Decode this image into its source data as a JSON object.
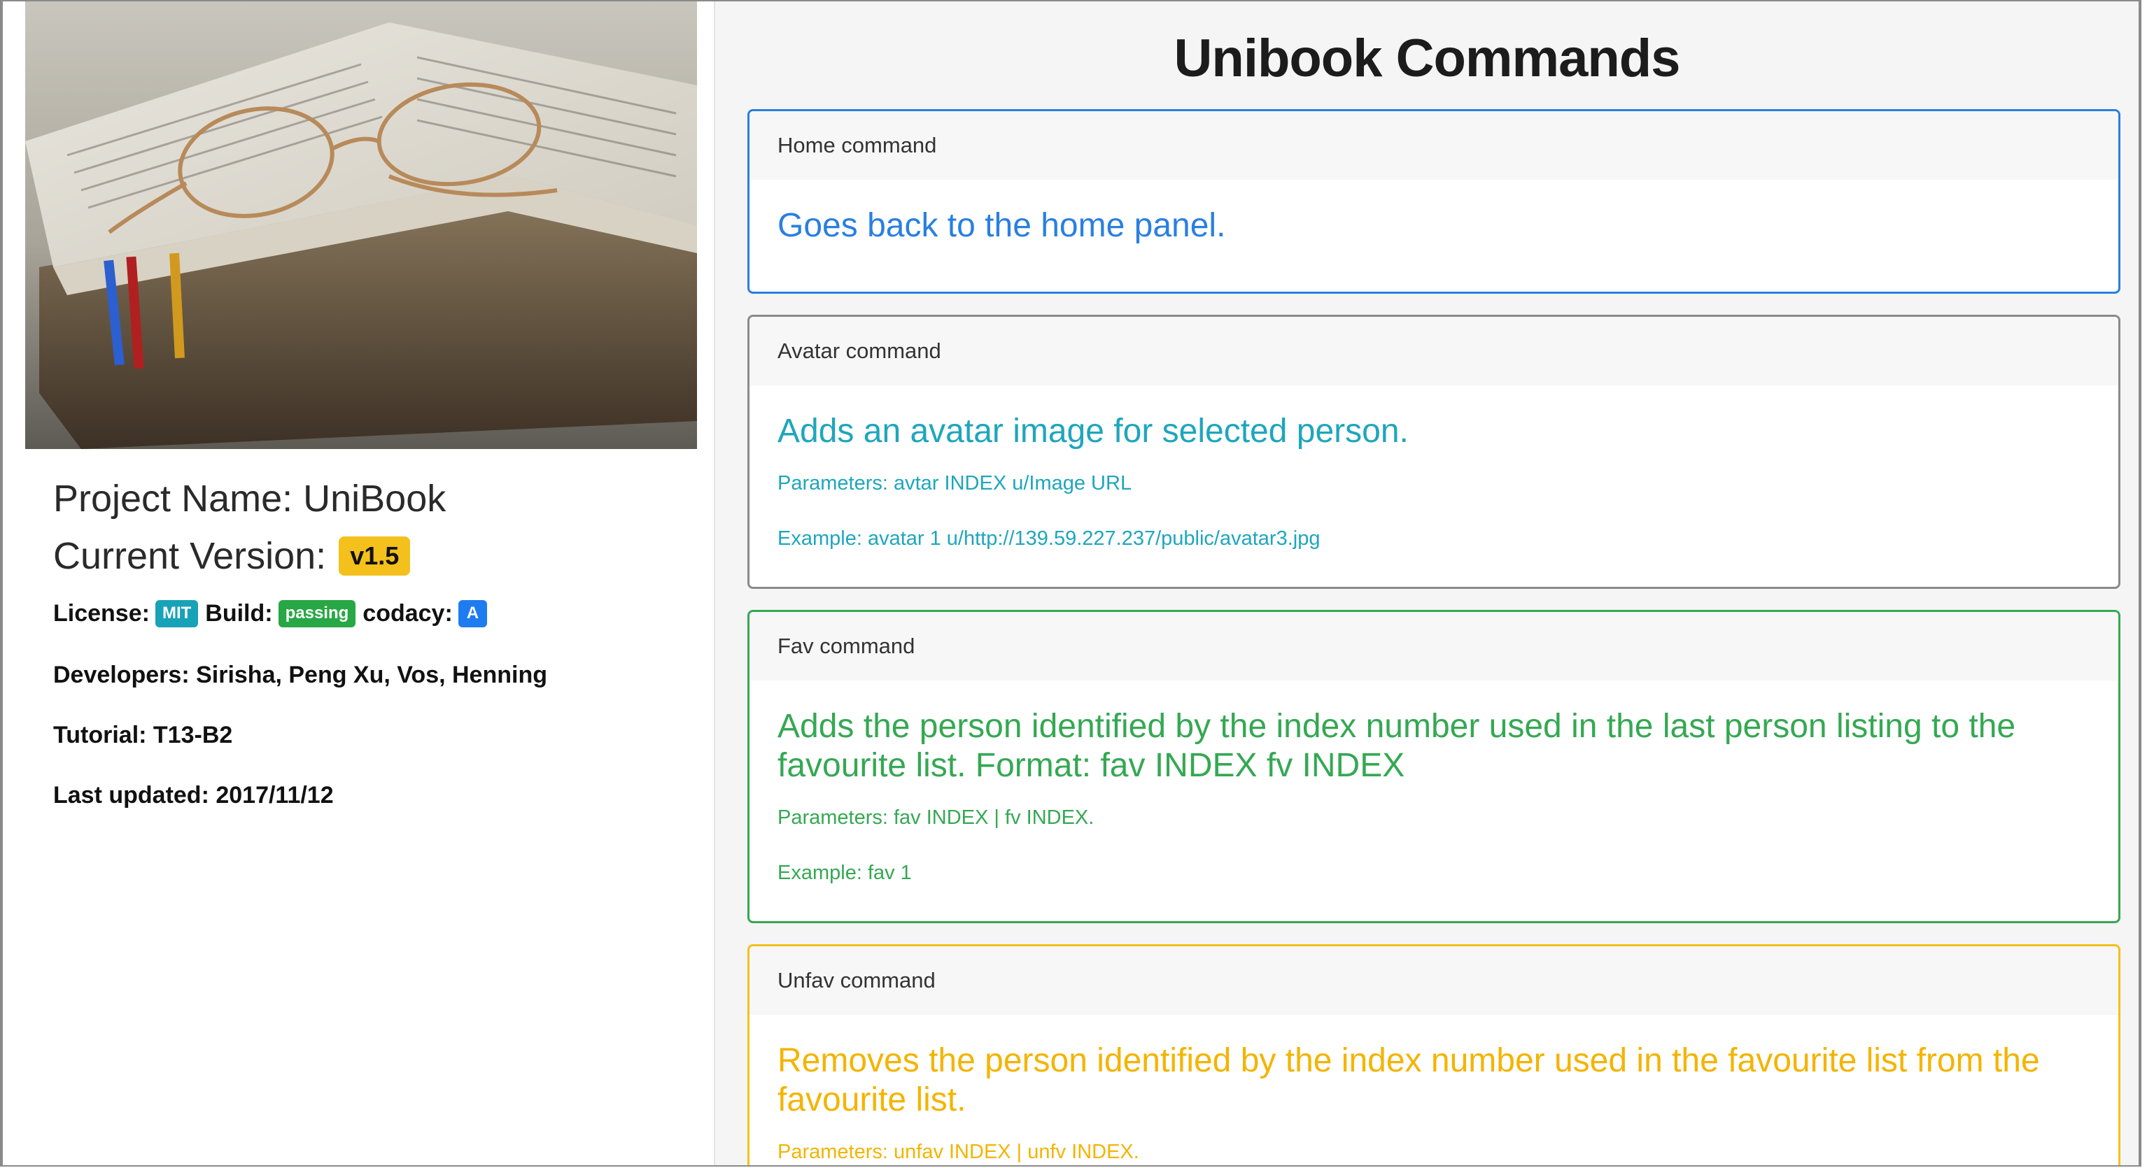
{
  "sidebar": {
    "project_name": "Project Name: UniBook",
    "current_version_label": "Current Version:",
    "version": "v1.5",
    "license_label": "License:",
    "license_badge": "MIT",
    "build_label": "Build:",
    "build_badge": "passing",
    "codacy_label": "codacy:",
    "codacy_badge": "A",
    "developers": "Developers: Sirisha, Peng Xu, Vos, Henning",
    "tutorial": "Tutorial: T13-B2",
    "last_updated": "Last updated: 2017/11/12"
  },
  "main": {
    "title": "Unibook Commands",
    "commands": [
      {
        "header": "Home command",
        "title": "Goes back to the home panel.",
        "color": "#2a7fe0"
      },
      {
        "header": "Avatar command",
        "title": "Adds an avatar image for selected person.",
        "parameters": "Parameters: avtar INDEX u/Image URL",
        "example": "Example: avatar 1 u/http://139.59.227.237/public/avatar3.jpg",
        "color": "#1ea6bd"
      },
      {
        "header": "Fav command",
        "title": "Adds the person identified by the index number used in the last person listing to the favourite list. Format: fav INDEX fv INDEX",
        "parameters": "Parameters: fav INDEX | fv INDEX.",
        "example": "Example: fav 1",
        "color": "#35a853"
      },
      {
        "header": "Unfav command",
        "title": "Removes the person identified by the index number used in the favourite list from the favourite list.",
        "parameters": "Parameters: unfav INDEX | unfv INDEX.",
        "color": "#f4b400"
      }
    ]
  },
  "colors": {
    "version_badge": "#f4c01c",
    "mit_badge": "#17a2b8",
    "passing_badge": "#28a745",
    "codacy_badge": "#1e7cf0"
  },
  "icons": {
    "cover_image": "open-book-with-glasses"
  }
}
